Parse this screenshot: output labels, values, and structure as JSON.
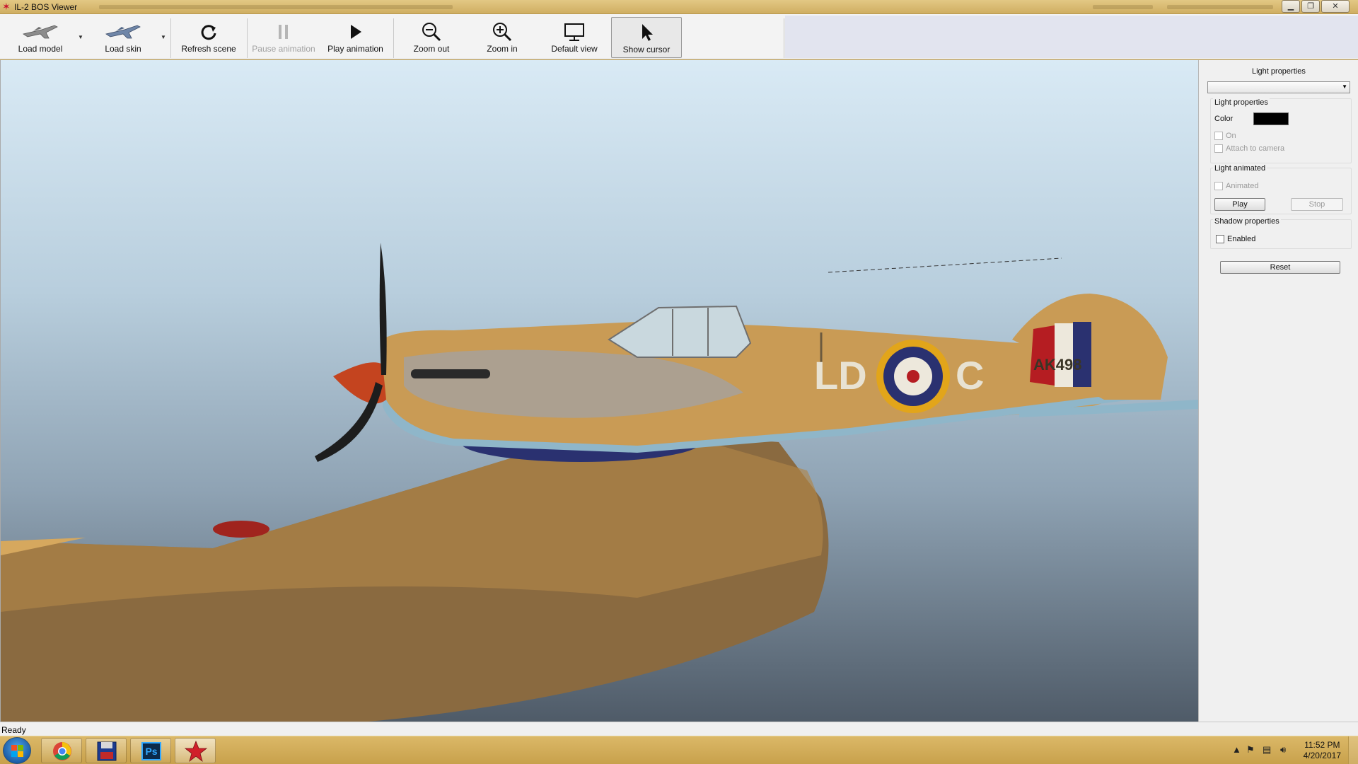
{
  "window": {
    "title": "IL-2 BOS Viewer"
  },
  "toolbar": {
    "load_model": "Load model",
    "load_skin": "Load skin",
    "refresh_scene": "Refresh scene",
    "pause_animation": "Pause animation",
    "play_animation": "Play animation",
    "zoom_out": "Zoom out",
    "zoom_in": "Zoom in",
    "default_view": "Default view",
    "show_cursor": "Show cursor"
  },
  "viewport": {
    "fuselage_code_left": "LD",
    "fuselage_code_right": "C",
    "serial": "AK498"
  },
  "panel": {
    "header": "Light properties",
    "dropdown_value": "",
    "group_light": {
      "title": "Light properties",
      "color_label": "Color",
      "color_value": "#000000",
      "on_label": "On",
      "attach_label": "Attach to camera"
    },
    "group_animated": {
      "title": "Light animated",
      "animated_label": "Animated",
      "play": "Play",
      "stop": "Stop"
    },
    "group_shadow": {
      "title": "Shadow properties",
      "enabled_label": "Enabled"
    },
    "reset": "Reset"
  },
  "status": {
    "text": "Ready"
  },
  "taskbar": {
    "apps": [
      "start-button",
      "chrome-icon",
      "floppy-app-icon",
      "photoshop-icon",
      "il2-viewer-icon"
    ],
    "photoshop_label": "Ps",
    "time": "11:52 PM",
    "date": "4/20/2017"
  },
  "colors": {
    "taskbar": "#c9a657",
    "toolbar": "#f3f3f3",
    "panel": "#f0f0f0",
    "roundel_blue": "#2a3170",
    "roundel_yellow": "#e2a51a",
    "roundel_red": "#b51d22"
  }
}
